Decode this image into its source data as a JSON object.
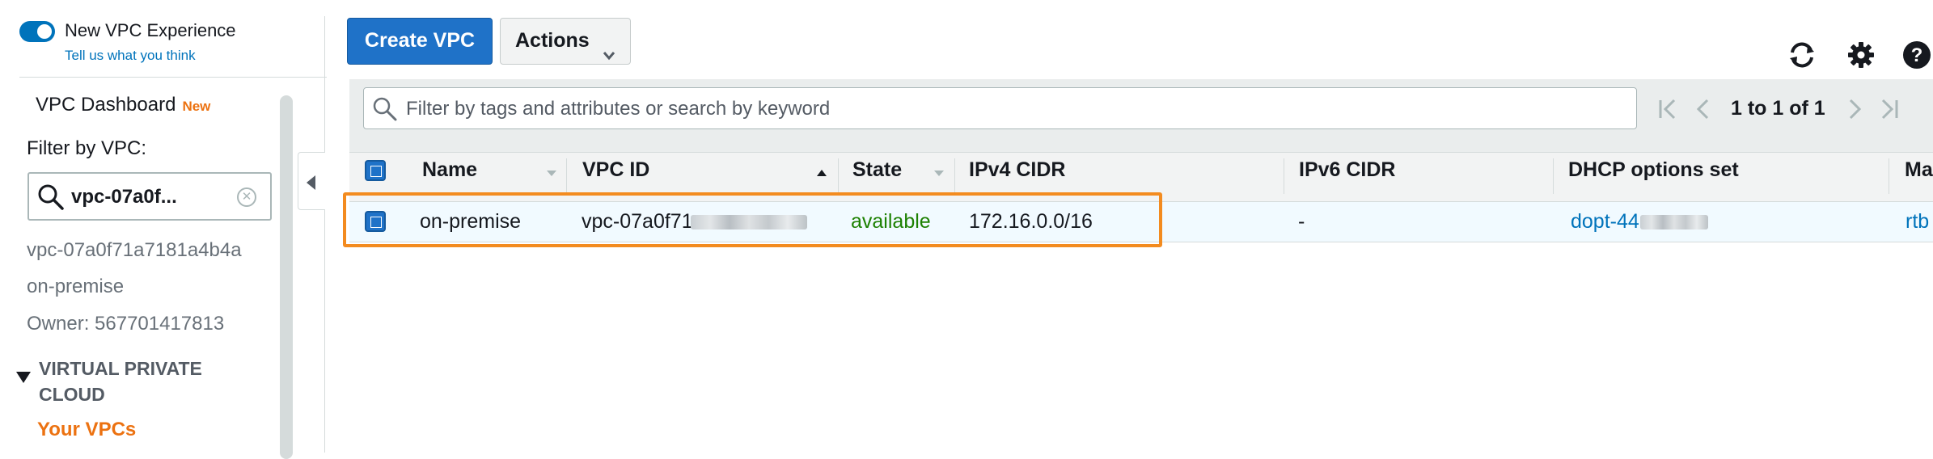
{
  "sidebar": {
    "toggle_label": "New VPC Experience",
    "feedback_link": "Tell us what you think",
    "dashboard_label": "VPC Dashboard",
    "dashboard_badge": "New",
    "filter_label": "Filter by VPC:",
    "filter_token": "vpc-07a0f...",
    "selected_vpc_id": "vpc-07a0f71a7181a4b4a",
    "selected_vpc_name": "on-premise",
    "selected_vpc_owner": "Owner: 567701417813",
    "section_title": "VIRTUAL PRIVATE CLOUD",
    "nav_your_vpcs": "Your VPCs"
  },
  "toolbar": {
    "create_label": "Create VPC",
    "actions_label": "Actions"
  },
  "search": {
    "placeholder": "Filter by tags and attributes or search by keyword"
  },
  "pagination": {
    "text": "1 to 1 of 1"
  },
  "table": {
    "columns": [
      "Name",
      "VPC ID",
      "State",
      "IPv4 CIDR",
      "IPv6 CIDR",
      "DHCP options set",
      "Ma"
    ],
    "rows": [
      {
        "name": "on-premise",
        "vpc_id": "vpc-07a0f71",
        "state": "available",
        "ipv4_cidr": "172.16.0.0/16",
        "ipv6_cidr": "-",
        "dhcp_options": "dopt-44",
        "main_route_table": "rtb"
      }
    ]
  },
  "colors": {
    "accent": "#0073bb",
    "primary_button": "#1f72c8",
    "active_nav": "#ec7211",
    "state_available": "#1d8102",
    "highlight_border": "#f38b1f"
  },
  "icons": [
    "search-icon",
    "refresh-icon",
    "gear-icon",
    "help-icon",
    "first-page-icon",
    "previous-page-icon",
    "next-page-icon",
    "last-page-icon",
    "chevron-down-icon",
    "collapse-icon"
  ]
}
